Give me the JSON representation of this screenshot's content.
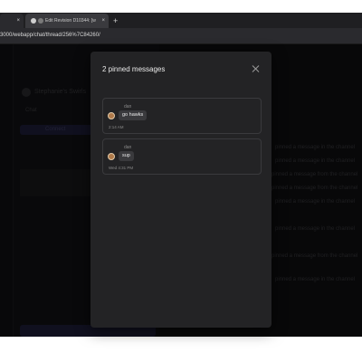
{
  "browser": {
    "tabs": [
      {
        "title": "",
        "close": "×"
      },
      {
        "title": "Edit Revision D10344: [w...",
        "close": "×"
      }
    ],
    "new_tab": "+",
    "url": "3000/webapp/chat/thread/256%7C84260/"
  },
  "background": {
    "workspace_name": "Stephanie's Swirls",
    "tab_label": "Chat",
    "button_label": "Connect",
    "messages": [
      "pinned a message in the channel",
      "pinned a message in the channel",
      "pinned a message from the channel",
      "pinned a message from the channel",
      "pinned a message in the channel",
      "pinned a message in the channel",
      "pinned a message from the channel",
      "pinned a message in the channel"
    ]
  },
  "modal": {
    "title": "2 pinned messages",
    "close_icon": "close-icon",
    "pins": [
      {
        "author": "dan",
        "text": "go hawks",
        "time": "2:14 AM"
      },
      {
        "author": "dan",
        "text": "sup",
        "time": "Wed 4:31 PM"
      }
    ]
  },
  "colors": {
    "modal_bg": "#232325",
    "page_bg": "#0f0f11",
    "bubble_bg": "#3a3a3d",
    "text": "#eaeaea",
    "muted": "#8a8a8a"
  }
}
